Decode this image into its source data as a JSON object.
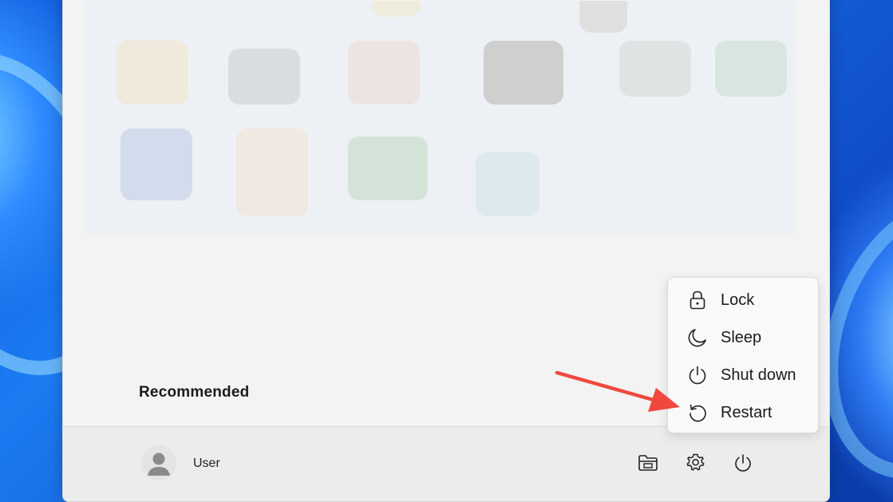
{
  "start_menu": {
    "recommended_heading": "Recommended",
    "user": {
      "name": "User"
    },
    "footer_icons": [
      "folder-icon",
      "settings-icon",
      "power-icon"
    ]
  },
  "power_menu": {
    "items": [
      {
        "label": "Lock",
        "icon": "lock-icon"
      },
      {
        "label": "Sleep",
        "icon": "sleep-icon"
      },
      {
        "label": "Shut down",
        "icon": "power-icon"
      },
      {
        "label": "Restart",
        "icon": "restart-icon"
      }
    ]
  },
  "annotation": {
    "arrow_color": "#f0483e",
    "points_to": "Restart"
  }
}
